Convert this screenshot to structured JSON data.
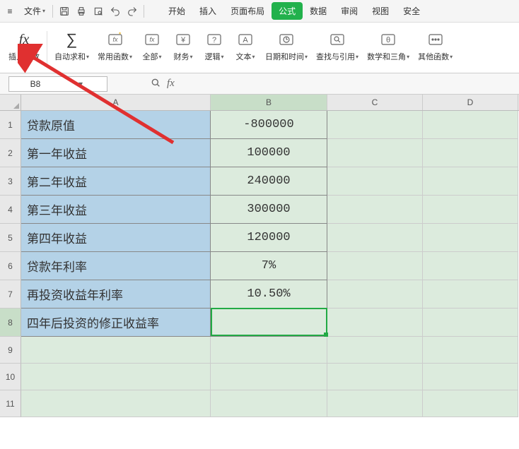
{
  "menubar": {
    "file": "文件",
    "tabs": [
      "开始",
      "插入",
      "页面布局",
      "公式",
      "数据",
      "审阅",
      "视图",
      "安全"
    ],
    "active_tab_index": 3
  },
  "ribbon": [
    {
      "icon": "fx",
      "label": "插入函数"
    },
    {
      "icon": "sigma",
      "label": "自动求和"
    },
    {
      "icon": "fn-star",
      "label": "常用函数"
    },
    {
      "icon": "fn-box",
      "label": "全部"
    },
    {
      "icon": "fn-yen",
      "label": "财务"
    },
    {
      "icon": "fn-q",
      "label": "逻辑"
    },
    {
      "icon": "fn-a",
      "label": "文本"
    },
    {
      "icon": "fn-clock",
      "label": "日期和时间"
    },
    {
      "icon": "fn-search",
      "label": "查找与引用"
    },
    {
      "icon": "fn-theta",
      "label": "数学和三角"
    },
    {
      "icon": "fn-dots",
      "label": "其他函数"
    }
  ],
  "namebox": {
    "ref": "B8"
  },
  "columns": [
    "A",
    "B",
    "C",
    "D"
  ],
  "selected_col": "B",
  "selected_row": 8,
  "rows": [
    {
      "n": "1",
      "a": "贷款原值",
      "b": "-800000"
    },
    {
      "n": "2",
      "a": "第一年收益",
      "b": "100000"
    },
    {
      "n": "3",
      "a": "第二年收益",
      "b": "240000"
    },
    {
      "n": "4",
      "a": "第三年收益",
      "b": "300000"
    },
    {
      "n": "5",
      "a": "第四年收益",
      "b": "120000"
    },
    {
      "n": "6",
      "a": "贷款年利率",
      "b": "7%"
    },
    {
      "n": "7",
      "a": "再投资收益年利率",
      "b": "10.50%"
    },
    {
      "n": "8",
      "a": "四年后投资的修正收益率",
      "b": ""
    },
    {
      "n": "9",
      "a": "",
      "b": ""
    },
    {
      "n": "10",
      "a": "",
      "b": ""
    },
    {
      "n": "11",
      "a": "",
      "b": ""
    }
  ]
}
